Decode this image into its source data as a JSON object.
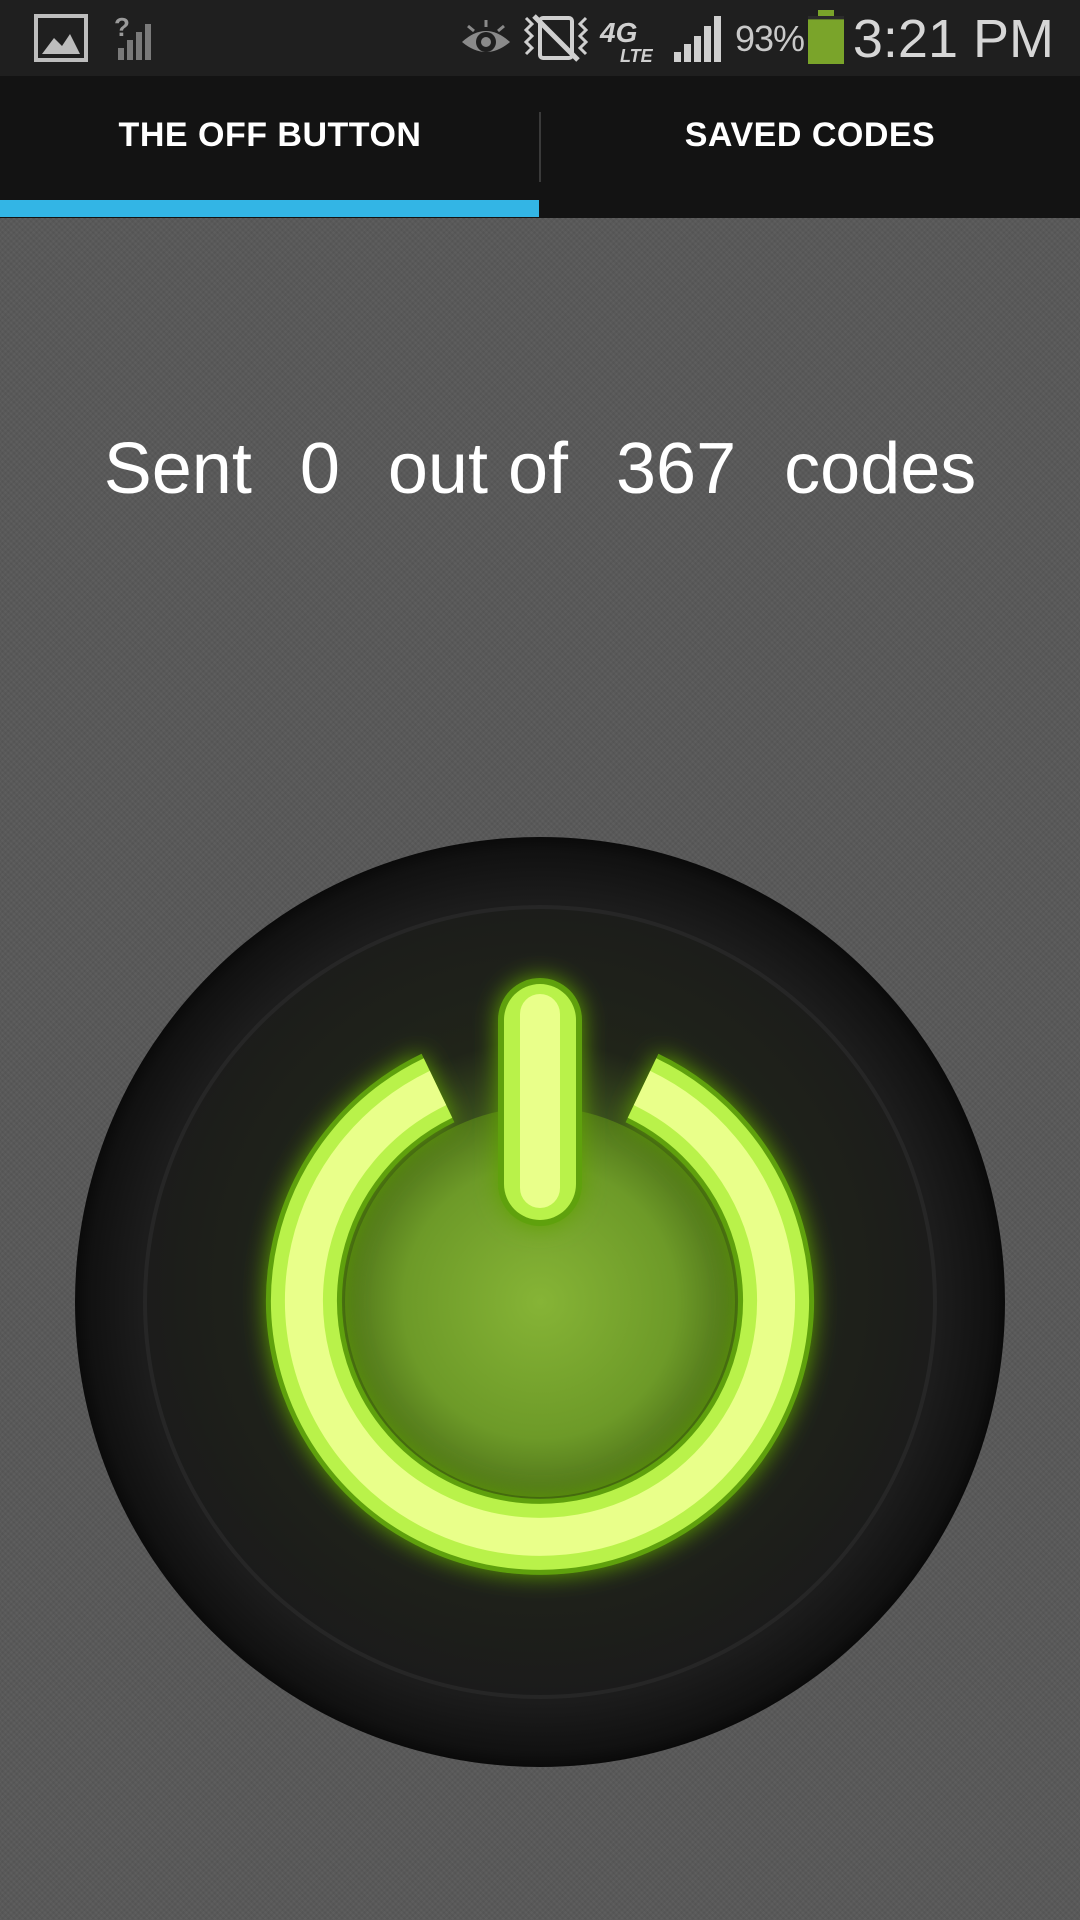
{
  "status_bar": {
    "battery_percent": "93%",
    "time": "3:21 PM",
    "icons": [
      "gallery-icon",
      "no-sim-signal-icon",
      "eye-icon",
      "mute-icon",
      "4g-lte-icon",
      "signal-icon",
      "battery-icon"
    ],
    "battery_color": "#7aa42a",
    "battery_level": 0.93
  },
  "tabs": [
    {
      "label": "THE OFF BUTTON",
      "selected": true
    },
    {
      "label": "SAVED CODES",
      "selected": false
    }
  ],
  "tab_indicator_color": "#33b5e5",
  "sent": {
    "prefix": "Sent",
    "count": "0",
    "middle": "out of",
    "total": "367",
    "suffix": "codes"
  },
  "power_button": {
    "icon": "power-icon",
    "glow_color": "#b8ff3c"
  }
}
